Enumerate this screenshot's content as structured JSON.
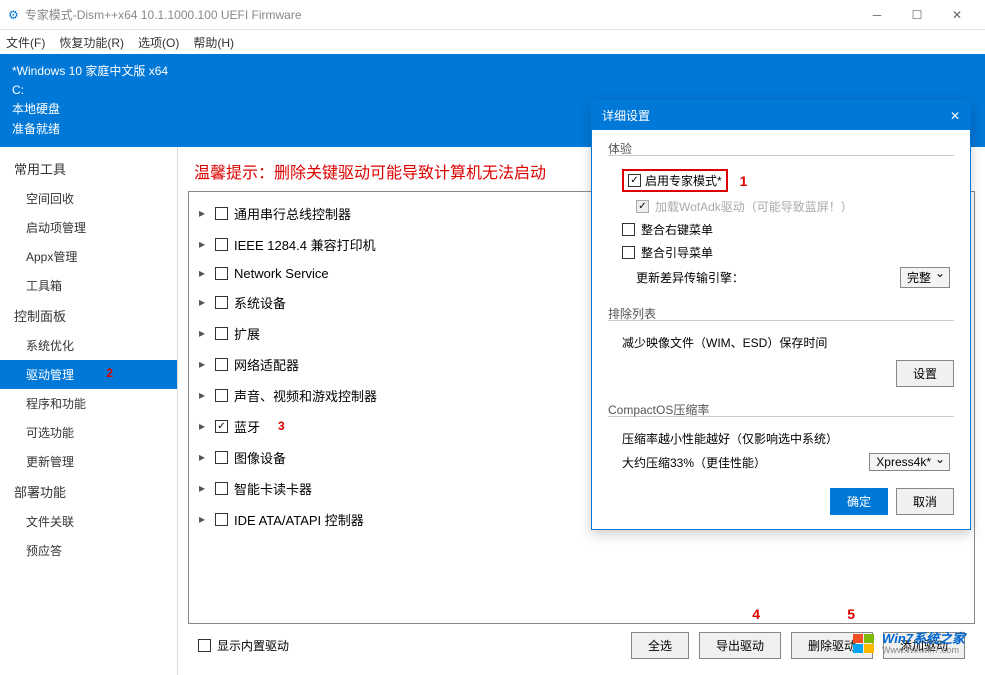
{
  "window": {
    "title": "专家模式-Dism++x64 10.1.1000.100 UEFI Firmware"
  },
  "menu": {
    "file": "文件(F)",
    "recover": "恢复功能(R)",
    "options": "选项(O)",
    "help": "帮助(H)"
  },
  "info": {
    "os": "*Windows 10 家庭中文版 x64",
    "drive": "C:",
    "disk": "本地硬盘",
    "status": "准备就绪"
  },
  "sidebar": {
    "sec1": "常用工具",
    "items1": [
      "空间回收",
      "启动项管理",
      "Appx管理",
      "工具箱"
    ],
    "sec2": "控制面板",
    "items2": [
      "系统优化",
      "驱动管理",
      "程序和功能",
      "可选功能",
      "更新管理"
    ],
    "sec3": "部署功能",
    "items3": [
      "文件关联",
      "预应答"
    ]
  },
  "content": {
    "warning": "温馨提示：删除关键驱动可能导致计算机无法启动",
    "tree": [
      {
        "label": "通用串行总线控制器",
        "checked": false
      },
      {
        "label": "IEEE 1284.4 兼容打印机",
        "checked": false
      },
      {
        "label": "Network Service",
        "checked": false
      },
      {
        "label": "系统设备",
        "checked": false
      },
      {
        "label": "扩展",
        "checked": false
      },
      {
        "label": "网络适配器",
        "checked": false
      },
      {
        "label": "声音、视频和游戏控制器",
        "checked": false
      },
      {
        "label": "蓝牙",
        "checked": true
      },
      {
        "label": "图像设备",
        "checked": false
      },
      {
        "label": "智能卡读卡器",
        "checked": false
      },
      {
        "label": "IDE ATA/ATAPI 控制器",
        "checked": false
      }
    ],
    "show_builtin": "显示内置驱动",
    "btn_all": "全选",
    "btn_export": "导出驱动",
    "btn_delete": "删除驱动",
    "btn_add": "添加驱动"
  },
  "dialog": {
    "title": "详细设置",
    "grp_experience": "体验",
    "expert_mode": "启用专家模式*",
    "wofadk": "加载WofAdk驱动（可能导致蓝屏！）",
    "right_menu": "整合右键菜单",
    "boot_menu": "整合引导菜单",
    "update_engine": "更新差异传输引擎：",
    "update_engine_val": "完整",
    "grp_exclude": "排除列表",
    "exclude_desc": "减少映像文件（WIM、ESD）保存时间",
    "btn_settings": "设置",
    "grp_compact": "CompactOS压缩率",
    "compact_desc": "压缩率越小性能越好（仅影响选中系统）",
    "compact_pct": "大约压缩33%（更佳性能）",
    "compact_val": "Xpress4k*",
    "btn_ok": "确定",
    "btn_cancel": "取消"
  },
  "annotations": {
    "n1": "1",
    "n2": "2",
    "n3": "3",
    "n4": "4",
    "n5": "5"
  },
  "watermark": {
    "cn": "Win7系统之家",
    "url": "Www.Winwin7.com"
  }
}
